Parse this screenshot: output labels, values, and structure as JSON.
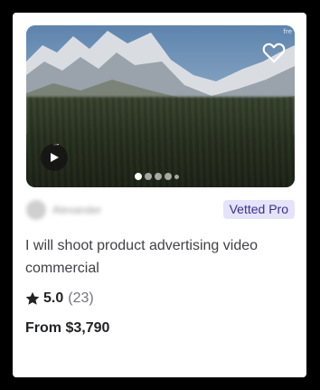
{
  "gig": {
    "media": {
      "watermark": "fre",
      "favorite_icon": "heart-outline-icon",
      "play_icon": "play-icon",
      "carousel": {
        "count": 5,
        "active_index": 0
      }
    },
    "seller": {
      "name": "Alexander",
      "avatar": "avatar-image"
    },
    "badge": "Vetted Pro",
    "title": "I will shoot product advertising video commercial",
    "rating": {
      "value": "5.0",
      "count": "(23)",
      "icon": "star-icon"
    },
    "price": "From $3,790"
  },
  "colors": {
    "badge_bg": "#e5e3fb",
    "badge_text": "#3a2f8a",
    "title_text": "#404145",
    "muted_text": "#74767e",
    "strong_text": "#222325"
  }
}
